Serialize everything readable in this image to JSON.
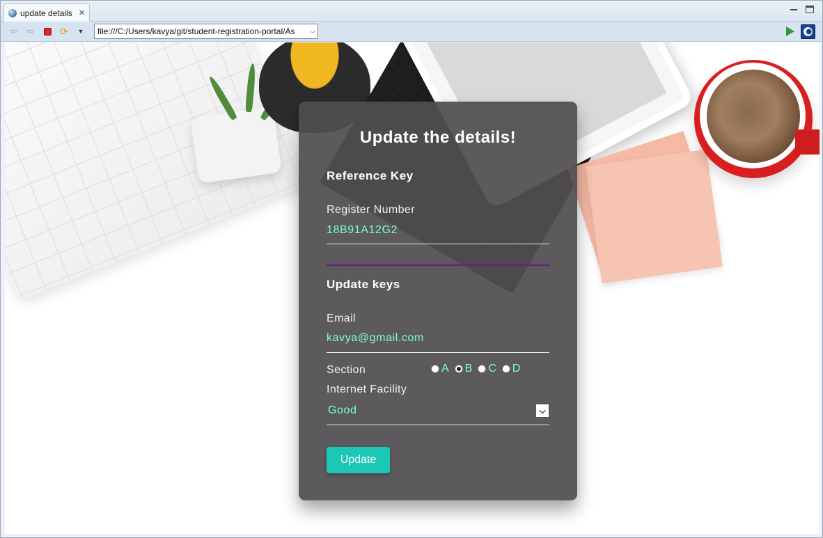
{
  "browser": {
    "tab_title": "update details",
    "url": "file:///C:/Users/kavya/git/student-registration-portal/As"
  },
  "form": {
    "title": "Update the details!",
    "reference_section": "Reference Key",
    "register_label": "Register Number",
    "register_value": "18B91A12G2",
    "update_section": "Update keys",
    "email_label": "Email",
    "email_value": "kavya@gmail.com",
    "section_label": "Section",
    "section_options": [
      "A",
      "B",
      "C",
      "D"
    ],
    "section_selected": "B",
    "internet_label": "Internet Facility",
    "internet_value": "Good",
    "update_button": "Update"
  },
  "colors": {
    "accent_text": "#7fffd4",
    "button": "#1cc7b6",
    "divider": "#6a1b8a",
    "card": "#504e50"
  }
}
